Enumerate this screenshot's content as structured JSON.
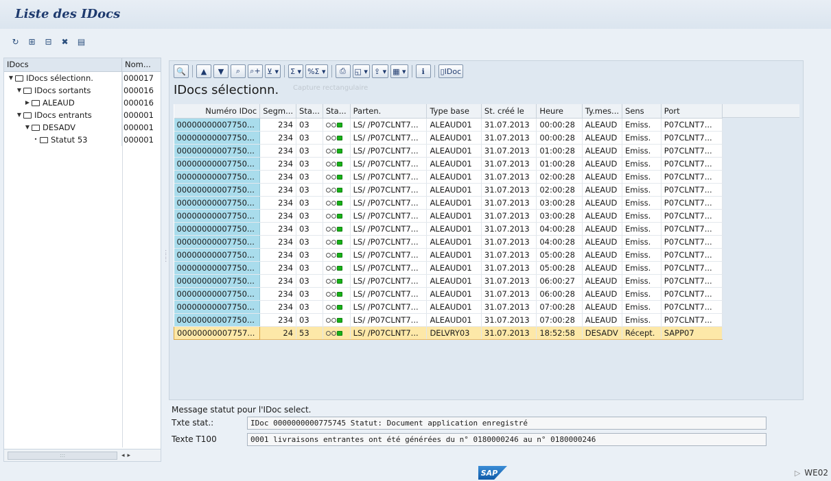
{
  "window": {
    "title": "Liste des IDocs"
  },
  "app_toolbar": {
    "icons": [
      "refresh-icon",
      "expand-all-icon",
      "collapse-all-icon",
      "delete-icon",
      "details-icon"
    ]
  },
  "tree": {
    "header": {
      "col1": "IDocs",
      "col2": "Nom..."
    },
    "nodes": [
      {
        "label": "IDocs sélectionn.",
        "count": "000017",
        "level": 0,
        "expanded": true
      },
      {
        "label": "IDocs sortants",
        "count": "000016",
        "level": 1,
        "expanded": true
      },
      {
        "label": "ALEAUD",
        "count": "000016",
        "level": 2,
        "expanded": false
      },
      {
        "label": "IDocs entrants",
        "count": "000001",
        "level": 1,
        "expanded": true
      },
      {
        "label": "DESADV",
        "count": "000001",
        "level": 2,
        "expanded": true
      },
      {
        "label": "Statut 53",
        "count": "000001",
        "level": 3,
        "expanded": false
      }
    ]
  },
  "alv": {
    "title": "IDocs sélectionn.",
    "faint_tooltip": "Capture rectangulaire",
    "idoc_button_label": "IDoc",
    "columns": [
      "Numéro IDoc",
      "Segm...",
      "Sta...",
      "Sta...",
      "Parten.",
      "Type base",
      "St. créé le",
      "Heure",
      "Ty.mes...",
      "Sens",
      "Port"
    ],
    "rows": [
      {
        "num": "00000000007750...",
        "segm": "234",
        "sta": "03",
        "parten": "LS/ /P07CLNT7...",
        "type": "ALEAUD01",
        "date": "31.07.2013",
        "heure": "00:00:28",
        "tymes": "ALEAUD",
        "sens": "Emiss.",
        "port": "P07CLNT7...",
        "selected": false
      },
      {
        "num": "00000000007750...",
        "segm": "234",
        "sta": "03",
        "parten": "LS/ /P07CLNT7...",
        "type": "ALEAUD01",
        "date": "31.07.2013",
        "heure": "00:00:28",
        "tymes": "ALEAUD",
        "sens": "Emiss.",
        "port": "P07CLNT7...",
        "selected": false
      },
      {
        "num": "00000000007750...",
        "segm": "234",
        "sta": "03",
        "parten": "LS/ /P07CLNT7...",
        "type": "ALEAUD01",
        "date": "31.07.2013",
        "heure": "01:00:28",
        "tymes": "ALEAUD",
        "sens": "Emiss.",
        "port": "P07CLNT7...",
        "selected": false
      },
      {
        "num": "00000000007750...",
        "segm": "234",
        "sta": "03",
        "parten": "LS/ /P07CLNT7...",
        "type": "ALEAUD01",
        "date": "31.07.2013",
        "heure": "01:00:28",
        "tymes": "ALEAUD",
        "sens": "Emiss.",
        "port": "P07CLNT7...",
        "selected": false
      },
      {
        "num": "00000000007750...",
        "segm": "234",
        "sta": "03",
        "parten": "LS/ /P07CLNT7...",
        "type": "ALEAUD01",
        "date": "31.07.2013",
        "heure": "02:00:28",
        "tymes": "ALEAUD",
        "sens": "Emiss.",
        "port": "P07CLNT7...",
        "selected": false
      },
      {
        "num": "00000000007750...",
        "segm": "234",
        "sta": "03",
        "parten": "LS/ /P07CLNT7...",
        "type": "ALEAUD01",
        "date": "31.07.2013",
        "heure": "02:00:28",
        "tymes": "ALEAUD",
        "sens": "Emiss.",
        "port": "P07CLNT7...",
        "selected": false
      },
      {
        "num": "00000000007750...",
        "segm": "234",
        "sta": "03",
        "parten": "LS/ /P07CLNT7...",
        "type": "ALEAUD01",
        "date": "31.07.2013",
        "heure": "03:00:28",
        "tymes": "ALEAUD",
        "sens": "Emiss.",
        "port": "P07CLNT7...",
        "selected": false
      },
      {
        "num": "00000000007750...",
        "segm": "234",
        "sta": "03",
        "parten": "LS/ /P07CLNT7...",
        "type": "ALEAUD01",
        "date": "31.07.2013",
        "heure": "03:00:28",
        "tymes": "ALEAUD",
        "sens": "Emiss.",
        "port": "P07CLNT7...",
        "selected": false
      },
      {
        "num": "00000000007750...",
        "segm": "234",
        "sta": "03",
        "parten": "LS/ /P07CLNT7...",
        "type": "ALEAUD01",
        "date": "31.07.2013",
        "heure": "04:00:28",
        "tymes": "ALEAUD",
        "sens": "Emiss.",
        "port": "P07CLNT7...",
        "selected": false
      },
      {
        "num": "00000000007750...",
        "segm": "234",
        "sta": "03",
        "parten": "LS/ /P07CLNT7...",
        "type": "ALEAUD01",
        "date": "31.07.2013",
        "heure": "04:00:28",
        "tymes": "ALEAUD",
        "sens": "Emiss.",
        "port": "P07CLNT7...",
        "selected": false
      },
      {
        "num": "00000000007750...",
        "segm": "234",
        "sta": "03",
        "parten": "LS/ /P07CLNT7...",
        "type": "ALEAUD01",
        "date": "31.07.2013",
        "heure": "05:00:28",
        "tymes": "ALEAUD",
        "sens": "Emiss.",
        "port": "P07CLNT7...",
        "selected": false
      },
      {
        "num": "00000000007750...",
        "segm": "234",
        "sta": "03",
        "parten": "LS/ /P07CLNT7...",
        "type": "ALEAUD01",
        "date": "31.07.2013",
        "heure": "05:00:28",
        "tymes": "ALEAUD",
        "sens": "Emiss.",
        "port": "P07CLNT7...",
        "selected": false
      },
      {
        "num": "00000000007750...",
        "segm": "234",
        "sta": "03",
        "parten": "LS/ /P07CLNT7...",
        "type": "ALEAUD01",
        "date": "31.07.2013",
        "heure": "06:00:27",
        "tymes": "ALEAUD",
        "sens": "Emiss.",
        "port": "P07CLNT7...",
        "selected": false
      },
      {
        "num": "00000000007750...",
        "segm": "234",
        "sta": "03",
        "parten": "LS/ /P07CLNT7...",
        "type": "ALEAUD01",
        "date": "31.07.2013",
        "heure": "06:00:28",
        "tymes": "ALEAUD",
        "sens": "Emiss.",
        "port": "P07CLNT7...",
        "selected": false
      },
      {
        "num": "00000000007750...",
        "segm": "234",
        "sta": "03",
        "parten": "LS/ /P07CLNT7...",
        "type": "ALEAUD01",
        "date": "31.07.2013",
        "heure": "07:00:28",
        "tymes": "ALEAUD",
        "sens": "Emiss.",
        "port": "P07CLNT7...",
        "selected": false
      },
      {
        "num": "00000000007750...",
        "segm": "234",
        "sta": "03",
        "parten": "LS/ /P07CLNT7...",
        "type": "ALEAUD01",
        "date": "31.07.2013",
        "heure": "07:00:28",
        "tymes": "ALEAUD",
        "sens": "Emiss.",
        "port": "P07CLNT7...",
        "selected": false
      },
      {
        "num": "00000000007757...",
        "segm": "24",
        "sta": "53",
        "parten": "LS/ /P07CLNT7...",
        "type": "DELVRY03",
        "date": "31.07.2013",
        "heure": "18:52:58",
        "tymes": "DESADV",
        "sens": "Récept.",
        "port": "SAPP07",
        "selected": true
      }
    ]
  },
  "status": {
    "title": "Message statut pour l'IDoc select.",
    "txte_label": "Txte stat.:",
    "txte_value": "IDoc 0000000000775745 Statut: Document application enregistré",
    "t100_label": "Texte T100",
    "t100_value": "0001 livraisons entrantes ont été générées du n° 0180000246 au n° 0180000246"
  },
  "footer": {
    "logo": "SAP",
    "transaction": "WE02"
  },
  "colors": {
    "accent_title": "#1e3a6e",
    "key_column": "#a9dcec",
    "selected_row": "#fde8a8",
    "status_green": "#19b219"
  }
}
